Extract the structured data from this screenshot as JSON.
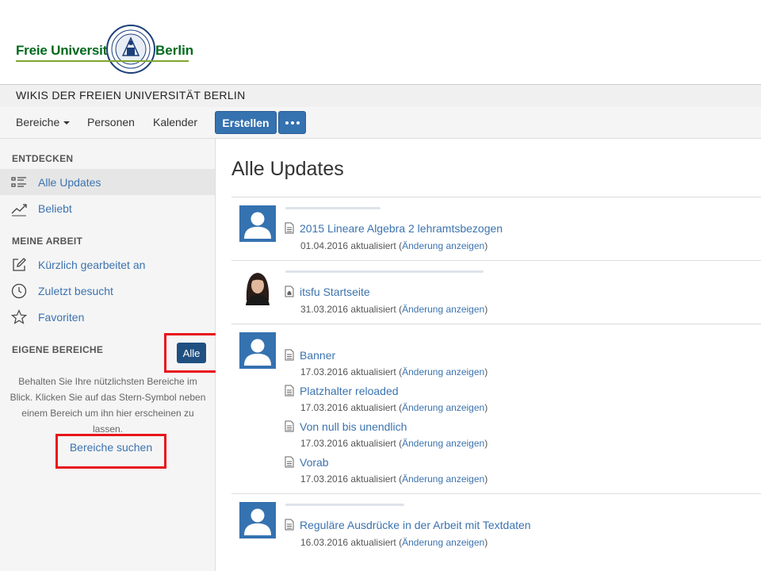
{
  "logo": {
    "left_text": "Freie Universität",
    "right_text": "Berlin"
  },
  "wiki_title": "WIKIS DER FREIEN UNIVERSITÄT BERLIN",
  "nav": {
    "spaces": "Bereiche",
    "people": "Personen",
    "calendar": "Kalender",
    "create": "Erstellen"
  },
  "sidebar": {
    "discover_heading": "ENTDECKEN",
    "all_updates": "Alle Updates",
    "popular": "Beliebt",
    "my_work_heading": "MEINE ARBEIT",
    "recently_worked": "Kürzlich gearbeitet an",
    "recently_visited": "Zuletzt besucht",
    "favorites": "Favoriten",
    "own_spaces_heading": "EIGENE BEREICHE",
    "all_button": "Alle",
    "hint_text": "Behalten Sie Ihre nützlichsten Bereiche im Blick. Klicken Sie auf das Stern-Symbol neben einem Bereich um ihn hier erscheinen zu lassen.",
    "find_spaces": "Bereiche suchen"
  },
  "main": {
    "title": "Alle Updates",
    "change_link": "Änderung anzeigen",
    "groups": [
      {
        "avatar": "default",
        "items": [
          {
            "title": "2015 Lineare Algebra 2 lehramtsbezogen",
            "date": "01.04.2016",
            "status": "aktualisiert",
            "icon": "page-icon"
          }
        ]
      },
      {
        "avatar": "photo",
        "items": [
          {
            "title": "itsfu Startseite",
            "date": "31.03.2016",
            "status": "aktualisiert",
            "icon": "home-page-icon"
          }
        ]
      },
      {
        "avatar": "default",
        "items": [
          {
            "title": "Banner",
            "date": "17.03.2016",
            "status": "aktualisiert",
            "icon": "page-icon"
          },
          {
            "title": "Platzhalter reloaded",
            "date": "17.03.2016",
            "status": "aktualisiert",
            "icon": "page-icon"
          },
          {
            "title": "Von null bis unendlich",
            "date": "17.03.2016",
            "status": "aktualisiert",
            "icon": "page-icon"
          },
          {
            "title": "Vorab",
            "date": "17.03.2016",
            "status": "aktualisiert",
            "icon": "page-icon"
          }
        ]
      },
      {
        "avatar": "default",
        "items": [
          {
            "title": "Reguläre Ausdrücke in der Arbeit mit Textdaten",
            "date": "16.03.2016",
            "status": "aktualisiert",
            "icon": "page-icon"
          }
        ]
      }
    ]
  },
  "colors": {
    "accent": "#3572b0",
    "link": "#3b73af",
    "fu_green": "#006a1d",
    "highlight": "#e8141c"
  }
}
